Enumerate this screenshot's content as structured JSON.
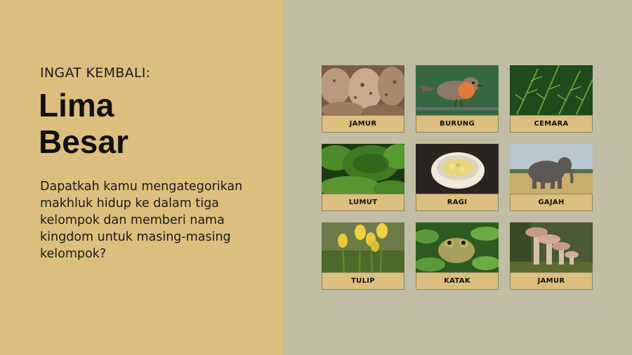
{
  "slide": {
    "kicker": "INGAT KEMBALI:",
    "title_line1": "Lima",
    "title_line2": "Besar",
    "body": "Dapatkah kamu mengategorikan makhluk hidup ke dalam tiga kelompok dan memberi nama kingdom untuk masing-masing kelompok?",
    "colors": {
      "left_bg": "#dcbf7f",
      "right_bg": "#bfbda3",
      "label_bg": "#dcbf7f"
    }
  },
  "cards": [
    {
      "label": "JAMUR",
      "icon": "fungus-texture-photo"
    },
    {
      "label": "BURUNG",
      "icon": "robin-bird-photo"
    },
    {
      "label": "CEMARA",
      "icon": "fir-branch-photo"
    },
    {
      "label": "LUMUT",
      "icon": "moss-photo"
    },
    {
      "label": "RAGI",
      "icon": "yeast-bowl-photo"
    },
    {
      "label": "GAJAH",
      "icon": "elephant-photo"
    },
    {
      "label": "TULIP",
      "icon": "tulip-photo"
    },
    {
      "label": "KATAK",
      "icon": "frog-photo"
    },
    {
      "label": "JAMUR",
      "icon": "mushroom-photo"
    }
  ]
}
